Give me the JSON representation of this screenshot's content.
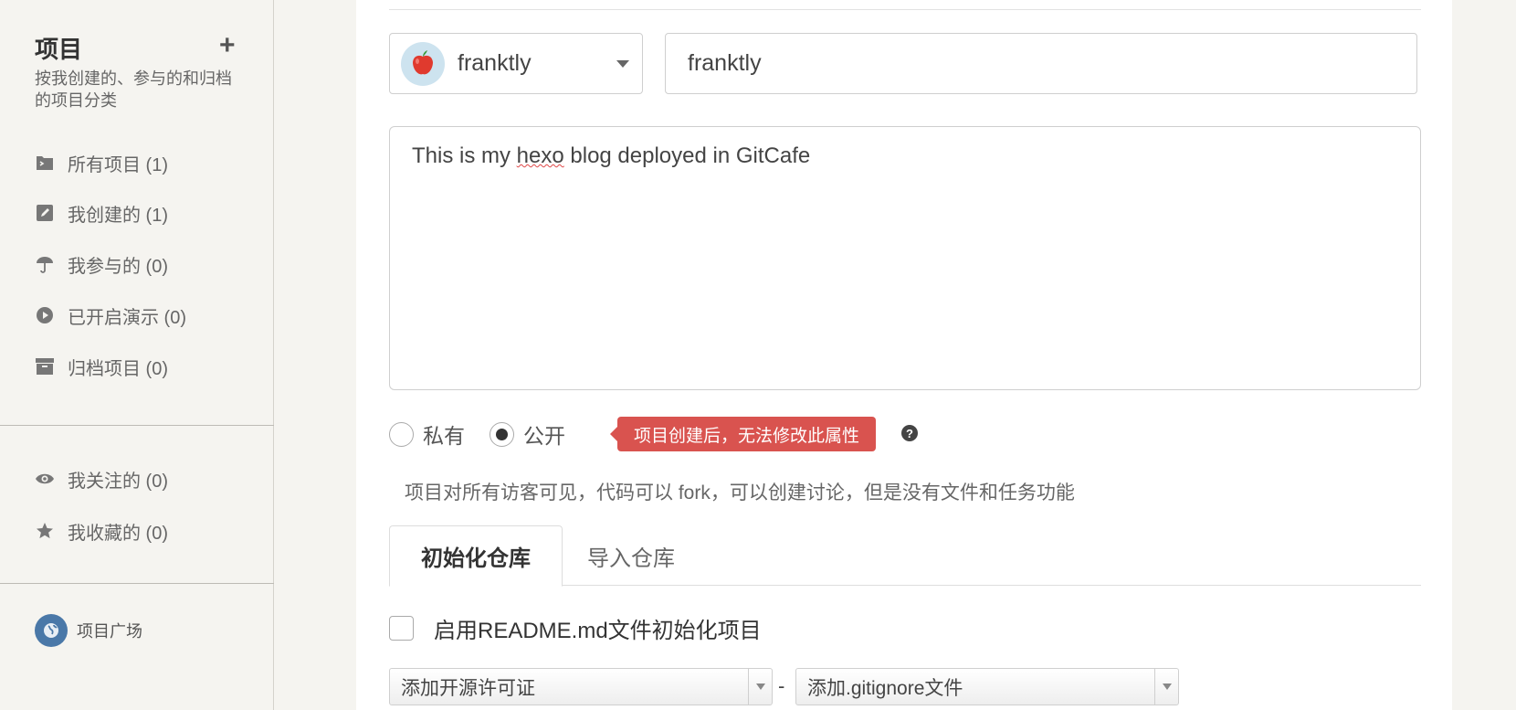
{
  "sidebar": {
    "title": "项目",
    "add_symbol": "+",
    "description": "按我创建的、参与的和归档的项目分类",
    "items": [
      {
        "label": "所有项目 (1)",
        "icon": "folder-icon"
      },
      {
        "label": "我创建的 (1)",
        "icon": "edit-icon"
      },
      {
        "label": "我参与的 (0)",
        "icon": "umbrella-icon"
      },
      {
        "label": "已开启演示 (0)",
        "icon": "play-icon"
      },
      {
        "label": "归档项目 (0)",
        "icon": "archive-icon"
      }
    ],
    "items2": [
      {
        "label": "我关注的 (0)",
        "icon": "eye-icon"
      },
      {
        "label": "我收藏的 (0)",
        "icon": "star-icon"
      }
    ],
    "plaza_label": "项目广场"
  },
  "form": {
    "owner": "franktly",
    "repo_name": "franktly",
    "description_prefix": "This is my ",
    "description_misspelled": "hexo",
    "description_suffix": " blog deployed in GitCafe",
    "visibility": {
      "private_label": "私有",
      "public_label": "公开",
      "selected": "public",
      "tooltip": "项目创建后，无法修改此属性",
      "help_symbol": "?",
      "note": "项目对所有访客可见，代码可以 fork，可以创建讨论，但是没有文件和任务功能"
    },
    "tabs": [
      {
        "label": "初始化仓库",
        "active": true
      },
      {
        "label": "导入仓库",
        "active": false
      }
    ],
    "readme_checkbox_label": "启用README.md文件初始化项目",
    "readme_checked": false,
    "license_select": "添加开源许可证",
    "separator": "-",
    "gitignore_select": "添加.gitignore文件"
  },
  "colors": {
    "tooltip_bg": "#d9534f",
    "plaza_globe": "#4a78a8",
    "sidebar_bg": "#f5f4f0"
  }
}
